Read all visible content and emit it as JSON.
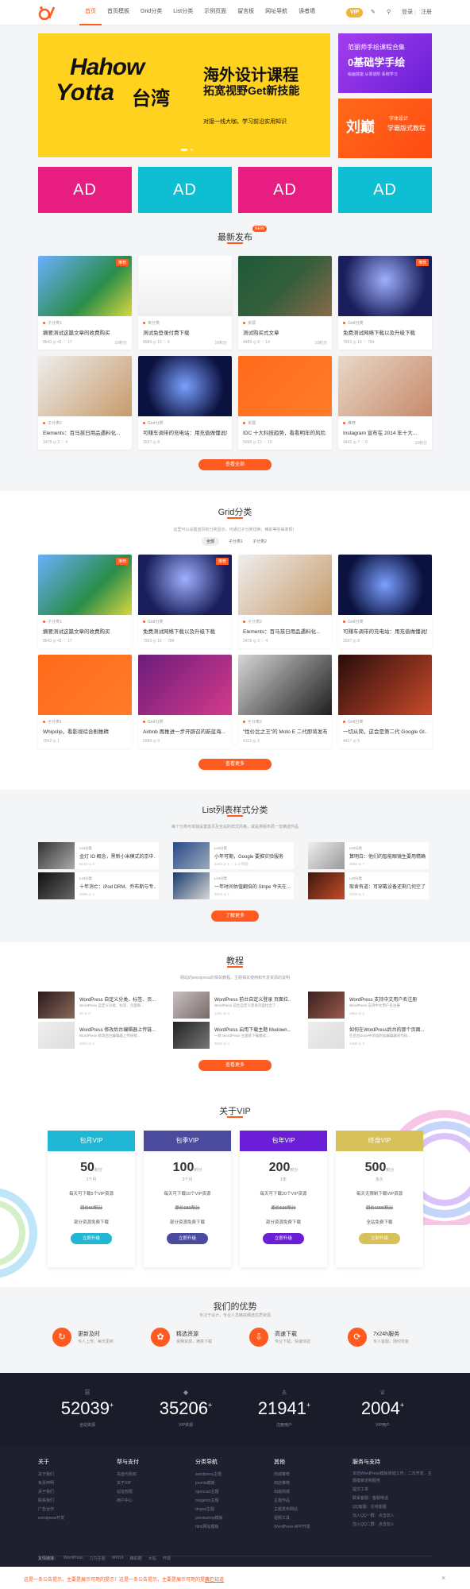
{
  "header": {
    "nav": [
      "首页",
      "首页模板",
      "Grid分类",
      "List分类",
      "示例页面",
      "留言板",
      "网址导航",
      "读者墙"
    ],
    "vip": "VIP",
    "login": "登录",
    "sep": "|",
    "register": "注册"
  },
  "banner": {
    "en1": "Hahow",
    "en2": "Yotta",
    "en3": "台湾",
    "t1": "海外设计课程",
    "t2": "拓宽视野Get新技能",
    "t3": "对接一线大咖，学习前沿实用知识"
  },
  "side1": {
    "t1": "范丽师手绘课程合集",
    "t2": "0基础学手绘",
    "t3": "绘画技能 从零进阶 系统学习"
  },
  "side2": {
    "t1": "刘巅",
    "t2": "字体设计",
    "t3": "学霸版式教程"
  },
  "ads": [
    "AD",
    "AD",
    "AD",
    "AD"
  ],
  "latest": {
    "title": "最新发布",
    "badge": "NEW",
    "more": "查看全部",
    "cards": [
      {
        "cat": "子分类1",
        "title": "摘要测试这篇文章的收费购买",
        "meta": "8643  ◎ 41  ♡ 17",
        "extra": "10积分",
        "tag": "推荐"
      },
      {
        "cat": "未分类",
        "title": "测试免登录付费下载",
        "meta": "8589  ◎ 15  ♡ 6",
        "extra": "10积分",
        "tag": ""
      },
      {
        "cat": "资源",
        "title": "测试购买式文章",
        "meta": "4489  ◎ 8  ♡ 14",
        "extra": "10积分",
        "tag": ""
      },
      {
        "cat": "Grid分类",
        "title": "免费测试网络下载以及升级下载",
        "meta": "7963  ◎ 16  ♡ 784",
        "extra": "",
        "tag": "推荐"
      },
      {
        "cat": "子分类2",
        "title": "Elements：百马孩日用品遇料化...",
        "meta": "3478  ◎ 3  ♡ 4",
        "extra": "",
        "tag": ""
      },
      {
        "cat": "Grid分类",
        "title": "可赚车调带的充电站：用充值做懂说服",
        "meta": "3597  ◎ 8",
        "extra": "",
        "tag": ""
      },
      {
        "cat": "资源",
        "title": "IDC 十大科技趋势，看看明年的风险...",
        "meta": "5098  ◎ 13  ♡ 10",
        "extra": "",
        "tag": ""
      },
      {
        "cat": "推荐",
        "title": "Instagram 宣布在 2014 年十大...",
        "meta": "4442  ◎ 7  ♡ 0",
        "extra": "10积分",
        "tag": ""
      }
    ]
  },
  "grid": {
    "title": "Grid分类",
    "sub": "这里可以设置首页的分类显示，可通过子分类切换，精彩等你来发现！",
    "tabs": [
      "全部",
      "子分类1",
      "子分类2"
    ],
    "more": "查看更多",
    "cards": [
      {
        "cat": "子分类1",
        "title": "摘要测试这篇文章的收费购买",
        "meta": "8643  ◎ 41  ♡ 17",
        "tag": "推荐"
      },
      {
        "cat": "Grid分类",
        "title": "免费测试网络下载以及升级下载",
        "meta": "7963  ◎ 16  ♡ 784",
        "tag": "推荐"
      },
      {
        "cat": "子分类2",
        "title": "Elements：百马孩日用品遇料化...",
        "meta": "3478  ◎ 3  ♡ 4",
        "tag": ""
      },
      {
        "cat": "Grid分类",
        "title": "可赚车调带的充电站：用充值做懂说服",
        "meta": "3597  ◎ 8",
        "tag": ""
      },
      {
        "cat": "子分类1",
        "title": "Whipclip，看影视综合剧推精",
        "meta": "7562  ◎ 1",
        "tag": ""
      },
      {
        "cat": "Grid分类",
        "title": "Airbnb 再推进一步开辟召的新蓝海...",
        "meta": "5589  ◎ 9",
        "tag": ""
      },
      {
        "cat": "子分类2",
        "title": "\"性价比之王\"的 Moto E 二代即将发布",
        "meta": "4113  ◎ 3",
        "tag": ""
      },
      {
        "cat": "Grid分类",
        "title": "一切从简，这会是第二代 Google Gl...",
        "meta": "4417  ◎ 5",
        "tag": ""
      }
    ]
  },
  "list": {
    "title": "List列表样式分类",
    "sub": "每个分类可单独设置首页及全站的样式风格，或是排版布局一览精选作品",
    "more": "了解更多",
    "rows": [
      {
        "cat": "List分类",
        "title": "金灯 IO 概念，黑新小米模式的京中...",
        "meta": "5142  ◎ 6"
      },
      {
        "cat": "List分类",
        "title": "小年可期，Google 要推实验服务",
        "meta": "4442  ◎ 1  ♡ 1 小时前"
      },
      {
        "cat": "List分类",
        "title": "算明白：他们的智能眼镜生要用精确的",
        "meta": "3586  ◎ 7"
      },
      {
        "cat": "List分类",
        "title": "十年消亡：iPod DRM、乔布斯与专...",
        "meta": "4596  ◎ 1"
      },
      {
        "cat": "List分类",
        "title": "一年时间估值翻倍的 Stripe 今天在...",
        "meta": "3514  ◎ 1"
      },
      {
        "cat": "List分类",
        "title": "取舍有道：可穿戴设备还剩几何空了...",
        "meta": "3426  ◎ 1"
      }
    ]
  },
  "tutorial": {
    "title": "教程",
    "sub": "网站的wordpress的相关教程，主题相关使用和开发资源的说明",
    "more": "查看更多",
    "rows": [
      {
        "title": "WordPress 自定义分类、标签、页...",
        "sub": "WordPress 自定义分类、标签、页面和...",
        "meta": "42  ◎ 0"
      },
      {
        "title": "WordPress 前台自定义登录 页面拉...",
        "sub": "WordPress 前台自定义登录页面拉出了...",
        "meta": "1441  ◎ 0"
      },
      {
        "title": "WordPress 支持中文用户名注册",
        "sub": "WordPress 支持中文用户名注册",
        "meta": "2964  ◎ 1"
      },
      {
        "title": "WordPress 修改后台编辑器上传链...",
        "sub": "WordPress 修改后台编辑器上传链接...",
        "meta": "1024  ◎ 1"
      },
      {
        "title": "WordPress 启用下载主题 Modown...",
        "sub": "一款 WordPress 主题的下载模式...",
        "meta": "2015  ◎ 4"
      },
      {
        "title": "如何在WordPress后台的那个页面...",
        "sub": "在后台Zone中添加附加编辑器的代码...",
        "meta": "4180  ◎ 0"
      }
    ]
  },
  "vip": {
    "title": "关于VIP",
    "plans": [
      {
        "name": "包月VIP",
        "price": "50",
        "unit": "积分",
        "dur": "1个月",
        "l1": "每天可下载5个VIP资源",
        "l2": "原价50积分",
        "l3": "部分资源免费下载",
        "btn": "立即升级",
        "color": "#20b7d4"
      },
      {
        "name": "包季VIP",
        "price": "100",
        "unit": "积分",
        "dur": "3个月",
        "l1": "每天可下载10个VIP资源",
        "l2": "原价150积分",
        "l3": "部分资源免费下载",
        "btn": "立即升级",
        "color": "#4b4b9e"
      },
      {
        "name": "包年VIP",
        "price": "200",
        "unit": "积分",
        "dur": "1年",
        "l1": "每天可下载20个VIP资源",
        "l2": "原价600积分",
        "l3": "部分资源免费下载",
        "btn": "立即升级",
        "color": "#6a1fd6"
      },
      {
        "name": "终身VIP",
        "price": "500",
        "unit": "积分",
        "dur": "永久",
        "l1": "每天无限制下载VIP资源",
        "l2": "原价1000积分",
        "l3": "全站免费下载",
        "btn": "立即升级",
        "color": "#d6c15a"
      }
    ]
  },
  "advantage": {
    "title": "我们的优势",
    "sub": "专注于设计，专业人员精挑细选优质资源",
    "items": [
      {
        "icon": "↻",
        "title": "更新及时",
        "sub": "专人上传，每天更新"
      },
      {
        "icon": "✿",
        "title": "精选资源",
        "sub": "良精资源，满意下载"
      },
      {
        "icon": "⇩",
        "title": "高速下载",
        "sub": "专业下载，快速体验"
      },
      {
        "icon": "⟳",
        "title": "7x24h服务",
        "sub": "专人客服，随时恢复"
      }
    ]
  },
  "stats": [
    {
      "icon": "☰",
      "n": "52039",
      "l": "全站资源"
    },
    {
      "icon": "◆",
      "n": "35206",
      "l": "VIP资源"
    },
    {
      "icon": "♙",
      "n": "21941",
      "l": "注册用户"
    },
    {
      "icon": "♕",
      "n": "2004",
      "l": "VIP用户"
    }
  ],
  "footer": {
    "cols": [
      {
        "h": "关于",
        "items": [
          "关于我们",
          "免责申明",
          "关于我们",
          "联系我们",
          "广告合作",
          "wordpress开发"
        ]
      },
      {
        "h": "帮与支付",
        "items": [
          "充值与购买",
          "关于VIP",
          "站址权限",
          "用户中心"
        ]
      },
      {
        "h": "分类导航",
        "items": [
          "wordpress主题",
          "joomla模板",
          "opencart主题",
          "magento主题",
          "drupal主题",
          "prestashop模板",
          "html网站模板"
        ]
      },
      {
        "h": "其他",
        "items": [
          "商城推荐",
          "商店推荐",
          "出版商城",
          "主题作品",
          "主题发布网站",
          "视频工具",
          "WordPress APP开发"
        ]
      },
      {
        "h": "服务与支持",
        "items": [
          "本店WordPress模板商城工作，二次开发，主题模板定制服务",
          "提交工单",
          "联系客服：客服电话",
          "QQ客服：在线客服",
          "加入QQ一群：点击加入",
          "加入QQ二群：点击加入"
        ]
      }
    ],
    "links_label": "友情链接：",
    "links": [
      "WordPress",
      "刀刀主题",
      "WPDX",
      "精彩酷",
      "大钻",
      "开源"
    ],
    "notice": "这是一条公告提示，主要是展示可用的提示！这是一条公告提示，主要是展示可用的提示！",
    "notice_link": "我已知道",
    "close": "×"
  },
  "colors": {
    "accent": "#ff5a1f",
    "dark": "#1b1c2a",
    "footer": "#1e2030"
  }
}
